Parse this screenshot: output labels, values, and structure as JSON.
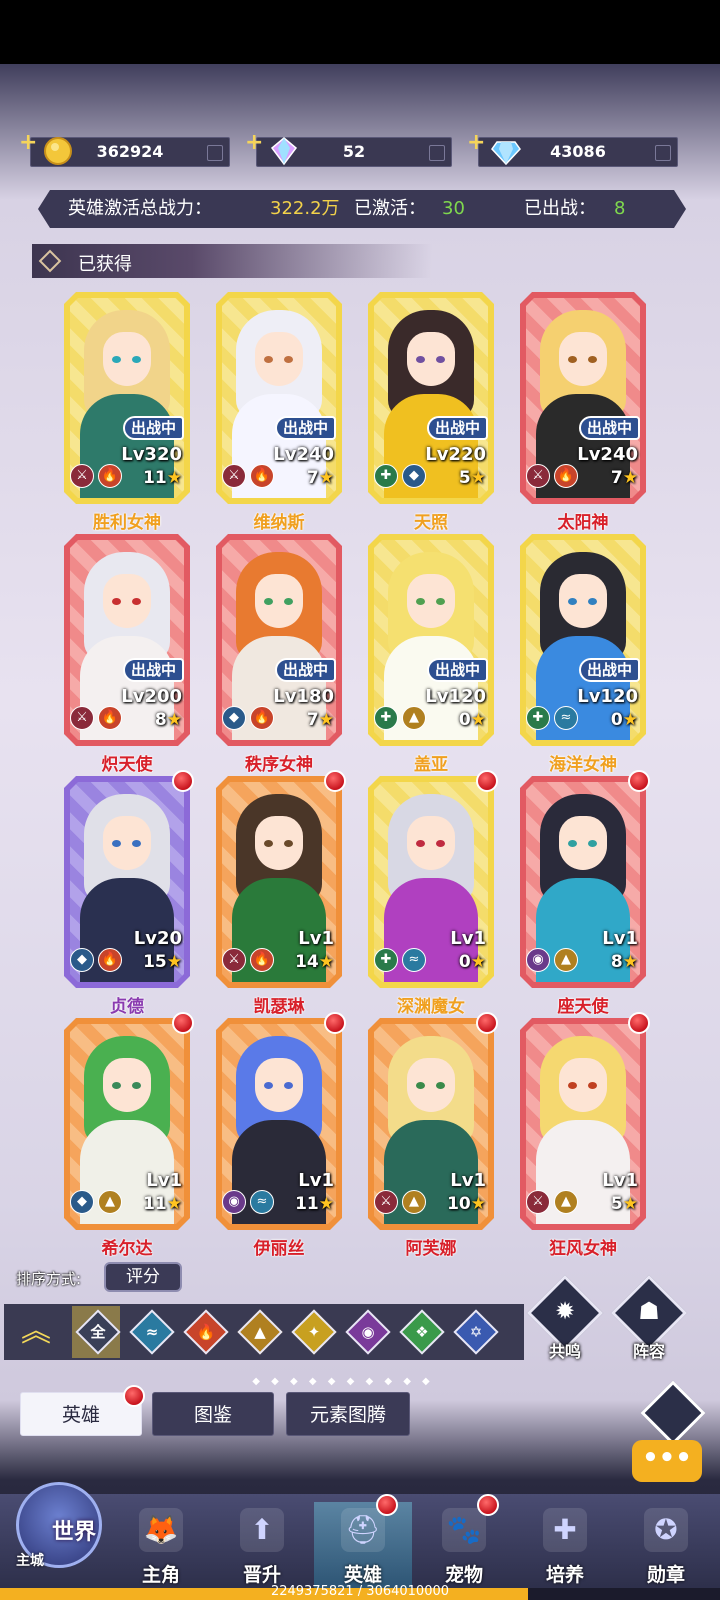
{
  "resources": [
    {
      "name": "gold",
      "value": "362924",
      "icon": "gold-coin-icon",
      "color": "#f3c73a"
    },
    {
      "name": "rainbow-gem",
      "value": "52",
      "icon": "rainbow-crystal-icon",
      "color": "#d9a0ff"
    },
    {
      "name": "diamond",
      "value": "43086",
      "icon": "blue-diamond-icon",
      "color": "#6cc8ff"
    }
  ],
  "stats": {
    "power_label": "英雄激活总战力：",
    "power_value": "322.2万",
    "activated_label": "已激活：",
    "activated_value": "30",
    "deployed_label": "已出战：",
    "deployed_value": "8"
  },
  "section_title": "已获得",
  "battle_label": "出战中",
  "heroes": [
    {
      "name": "胜利女神",
      "level": "Lv320",
      "stars": "11",
      "frame": "gold",
      "deployed": true,
      "badge": false,
      "elements": [
        "⚔",
        "🔥"
      ],
      "el_colors": [
        "#8a2a3a",
        "#c8442a"
      ],
      "name_color": "#f0a020",
      "hair": "#f1d48a",
      "outfit": "#2e7a6a",
      "eyes": "#2aa8b8"
    },
    {
      "name": "维纳斯",
      "level": "Lv240",
      "stars": "7",
      "frame": "gold",
      "deployed": true,
      "badge": false,
      "elements": [
        "⚔",
        "🔥"
      ],
      "el_colors": [
        "#8a2a3a",
        "#c8442a"
      ],
      "name_color": "#f0a020",
      "hair": "#eeeef6",
      "outfit": "#f5f5ff",
      "eyes": "#c07040"
    },
    {
      "name": "天照",
      "level": "Lv220",
      "stars": "5",
      "frame": "gold",
      "deployed": true,
      "badge": false,
      "elements": [
        "✚",
        "◆"
      ],
      "el_colors": [
        "#2a7a4a",
        "#2a5a8a"
      ],
      "name_color": "#f0a020",
      "hair": "#3a2a2a",
      "outfit": "#f0c020",
      "eyes": "#7050a0"
    },
    {
      "name": "太阳神",
      "level": "Lv240",
      "stars": "7",
      "frame": "red",
      "deployed": true,
      "badge": false,
      "elements": [
        "⚔",
        "🔥"
      ],
      "el_colors": [
        "#8a2a3a",
        "#c8442a"
      ],
      "name_color": "#d8202a",
      "hair": "#f5d070",
      "outfit": "#2a2a2a",
      "eyes": "#a06020"
    },
    {
      "name": "炽天使",
      "level": "Lv200",
      "stars": "8",
      "frame": "red",
      "deployed": true,
      "badge": false,
      "elements": [
        "⚔",
        "🔥"
      ],
      "el_colors": [
        "#8a2a3a",
        "#c8442a"
      ],
      "name_color": "#d8202a",
      "hair": "#e8e8f0",
      "outfit": "#f4f0f0",
      "eyes": "#c83030"
    },
    {
      "name": "秩序女神",
      "level": "Lv180",
      "stars": "7",
      "frame": "red",
      "deployed": true,
      "badge": false,
      "elements": [
        "◆",
        "🔥"
      ],
      "el_colors": [
        "#2a5a8a",
        "#c8442a"
      ],
      "name_color": "#d8202a",
      "hair": "#e87a30",
      "outfit": "#f0e8e0",
      "eyes": "#40a060"
    },
    {
      "name": "盖亚",
      "level": "Lv120",
      "stars": "0",
      "frame": "gold",
      "deployed": true,
      "badge": false,
      "elements": [
        "✚",
        "▲"
      ],
      "el_colors": [
        "#2a7a4a",
        "#b08020"
      ],
      "name_color": "#f0a020",
      "hair": "#f5e070",
      "outfit": "#fafaf0",
      "eyes": "#50a050"
    },
    {
      "name": "海洋女神",
      "level": "Lv120",
      "stars": "0",
      "frame": "gold",
      "deployed": true,
      "badge": false,
      "elements": [
        "✚",
        "≈"
      ],
      "el_colors": [
        "#2a7a4a",
        "#2a7aa0"
      ],
      "name_color": "#f0a020",
      "hair": "#2a2a32",
      "outfit": "#3a8ae0",
      "eyes": "#3080c0"
    },
    {
      "name": "贞德",
      "level": "Lv20",
      "stars": "15",
      "frame": "purple",
      "deployed": false,
      "badge": true,
      "elements": [
        "◆",
        "🔥"
      ],
      "el_colors": [
        "#2a5a8a",
        "#c8442a"
      ],
      "name_color": "#8a3ab0",
      "hair": "#e0e0e8",
      "outfit": "#2a3050",
      "eyes": "#3a70c0"
    },
    {
      "name": "凯瑟琳",
      "level": "Lv1",
      "stars": "14",
      "frame": "orange",
      "deployed": false,
      "badge": true,
      "elements": [
        "⚔",
        "🔥"
      ],
      "el_colors": [
        "#8a2a3a",
        "#c8442a"
      ],
      "name_color": "#d8202a",
      "hair": "#4a3628",
      "outfit": "#2a7a3a",
      "eyes": "#6a4a2a"
    },
    {
      "name": "深渊魔女",
      "level": "Lv1",
      "stars": "0",
      "frame": "gold",
      "deployed": false,
      "badge": true,
      "elements": [
        "✚",
        "≈"
      ],
      "el_colors": [
        "#2a7a4a",
        "#2a7aa0"
      ],
      "name_color": "#f0a020",
      "hair": "#d8d8e4",
      "outfit": "#b040c0",
      "eyes": "#c02a40"
    },
    {
      "name": "座天使",
      "level": "Lv1",
      "stars": "8",
      "frame": "red",
      "deployed": false,
      "badge": true,
      "elements": [
        "◉",
        "▲"
      ],
      "el_colors": [
        "#6a3a8a",
        "#b08020"
      ],
      "name_color": "#d8202a",
      "hair": "#2a2a3a",
      "outfit": "#30a8c8",
      "eyes": "#30a0a0"
    },
    {
      "name": "希尔达",
      "level": "Lv1",
      "stars": "11",
      "frame": "orange",
      "deployed": false,
      "badge": true,
      "elements": [
        "◆",
        "▲"
      ],
      "el_colors": [
        "#2a5a8a",
        "#b08020"
      ],
      "name_color": "#d8202a",
      "hair": "#4ab050",
      "outfit": "#f0f0e8",
      "eyes": "#3a8a5a"
    },
    {
      "name": "伊丽丝",
      "level": "Lv1",
      "stars": "11",
      "frame": "orange",
      "deployed": false,
      "badge": true,
      "elements": [
        "◉",
        "≈"
      ],
      "el_colors": [
        "#6a3a8a",
        "#2a7aa0"
      ],
      "name_color": "#d8202a",
      "hair": "#5a7ae8",
      "outfit": "#2a2a38",
      "eyes": "#4a6ad0"
    },
    {
      "name": "阿芙娜",
      "level": "Lv1",
      "stars": "10",
      "frame": "orange",
      "deployed": false,
      "badge": true,
      "elements": [
        "⚔",
        "▲"
      ],
      "el_colors": [
        "#8a2a3a",
        "#b08020"
      ],
      "name_color": "#d8202a",
      "hair": "#f3dc8a",
      "outfit": "#2a6a5a",
      "eyes": "#3a8a4a"
    },
    {
      "name": "狂风女神",
      "level": "Lv1",
      "stars": "5",
      "frame": "red",
      "deployed": false,
      "badge": true,
      "elements": [
        "⚔",
        "▲"
      ],
      "el_colors": [
        "#8a2a3a",
        "#b08020"
      ],
      "name_color": "#d8202a",
      "hair": "#f5d870",
      "outfit": "#f4f0f0",
      "eyes": "#c04020"
    }
  ],
  "sort": {
    "label": "排序方式:",
    "value": "评分"
  },
  "filters": [
    {
      "name": "all",
      "glyph": "全",
      "color": "#3a4058"
    },
    {
      "name": "water",
      "glyph": "≈",
      "color": "#2a7aa0"
    },
    {
      "name": "fire",
      "glyph": "🔥",
      "color": "#c8442a"
    },
    {
      "name": "earth",
      "glyph": "▲",
      "color": "#b08020"
    },
    {
      "name": "light",
      "glyph": "✦",
      "color": "#c8a020"
    },
    {
      "name": "dark",
      "glyph": "◉",
      "color": "#7a3a9a"
    },
    {
      "name": "wind",
      "glyph": "❖",
      "color": "#3a9a4a"
    },
    {
      "name": "star",
      "glyph": "✡",
      "color": "#3a5ab0"
    }
  ],
  "side_buttons": {
    "resonance": "共鸣",
    "formation": "阵容"
  },
  "tabs": [
    {
      "label": "英雄",
      "active": true,
      "badge": true
    },
    {
      "label": "图鉴",
      "active": false,
      "badge": false
    },
    {
      "label": "元素图腾",
      "active": false,
      "badge": false
    }
  ],
  "chat_label": "•••",
  "nav": {
    "world": "世界",
    "main_city": "主城",
    "items": [
      {
        "label": "主角",
        "icon": "fox-icon",
        "glyph": "🦊",
        "active": false,
        "badge": false
      },
      {
        "label": "晋升",
        "icon": "promote-icon",
        "glyph": "⬆",
        "active": false,
        "badge": false
      },
      {
        "label": "英雄",
        "icon": "helmet-icon",
        "glyph": "⛑",
        "active": true,
        "badge": true
      },
      {
        "label": "宠物",
        "icon": "pet-icon",
        "glyph": "🐾",
        "active": false,
        "badge": true
      },
      {
        "label": "培养",
        "icon": "cultivate-icon",
        "glyph": "✚",
        "active": false,
        "badge": false
      },
      {
        "label": "勋章",
        "icon": "medal-icon",
        "glyph": "✪",
        "active": false,
        "badge": false
      }
    ]
  },
  "progress": {
    "text": "2249375821 / 3064010000",
    "fraction": 0.734
  }
}
